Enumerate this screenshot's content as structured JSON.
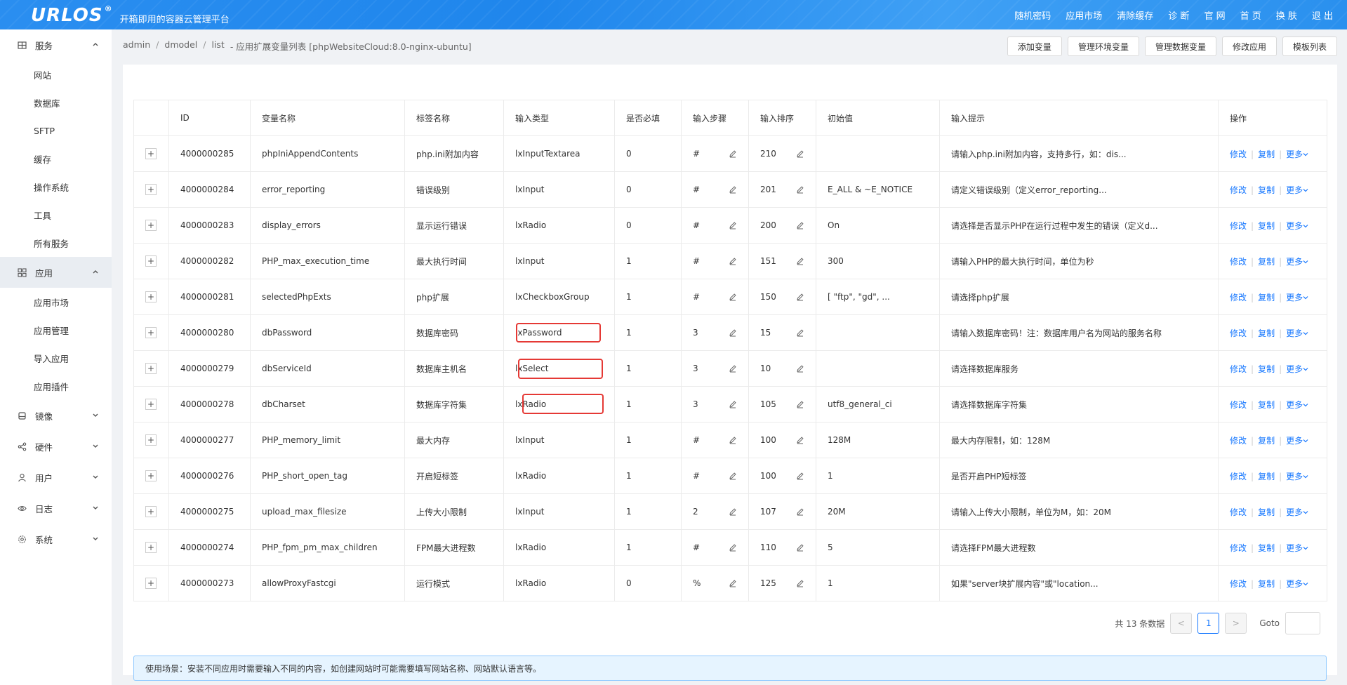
{
  "header": {
    "logo": "URLOS",
    "logo_mark": "®",
    "slogan": "开箱即用的容器云管理平台",
    "nav": [
      "随机密码",
      "应用市场",
      "清除缓存",
      "诊 断",
      "官 网",
      "首 页",
      "换 肤",
      "退 出"
    ]
  },
  "sidebar": {
    "groups": [
      {
        "label": "服务",
        "icon": "grid-icon",
        "expanded": true,
        "items": [
          "网站",
          "数据库",
          "SFTP",
          "缓存",
          "操作系统",
          "工具",
          "所有服务"
        ]
      },
      {
        "label": "应用",
        "icon": "apps-icon",
        "expanded": true,
        "active": true,
        "items": [
          "应用市场",
          "应用管理",
          "导入应用",
          "应用插件"
        ]
      },
      {
        "label": "镜像",
        "icon": "disk-icon",
        "expanded": false,
        "items": []
      },
      {
        "label": "硬件",
        "icon": "share-icon",
        "expanded": false,
        "items": []
      },
      {
        "label": "用户",
        "icon": "user-icon",
        "expanded": false,
        "items": []
      },
      {
        "label": "日志",
        "icon": "eye-icon",
        "expanded": false,
        "items": []
      },
      {
        "label": "系统",
        "icon": "gear-icon",
        "expanded": false,
        "items": []
      }
    ]
  },
  "breadcrumb": [
    "admin",
    "dmodel",
    "list",
    "-  应用扩展变量列表 [phpWebsiteCloud:8.0-nginx-ubuntu]"
  ],
  "actions": [
    "添加变量",
    "管理环境变量",
    "管理数据变量",
    "修改应用",
    "模板列表"
  ],
  "table": {
    "columns": [
      "",
      "ID",
      "变量名称",
      "标签名称",
      "输入类型",
      "是否必填",
      "输入步骤",
      "输入排序",
      "初始值",
      "输入提示",
      "操作"
    ],
    "rows": [
      {
        "id": "4000000285",
        "name": "phpIniAppendContents",
        "label": "php.ini附加内容",
        "type": "lxInputTextarea",
        "required": "0",
        "step": "#",
        "order": "210",
        "init": "",
        "hint": "请输入php.ini附加内容，支持多行，如：dis..."
      },
      {
        "id": "4000000284",
        "name": "error_reporting",
        "label": "错误级别",
        "type": "lxInput",
        "required": "0",
        "step": "#",
        "order": "201",
        "init": "E_ALL & ~E_NOTICE",
        "hint": "请定义错误级别（定义error_reporting..."
      },
      {
        "id": "4000000283",
        "name": "display_errors",
        "label": "显示运行错误",
        "type": "lxRadio",
        "required": "0",
        "step": "#",
        "order": "200",
        "init": "On",
        "hint": "请选择是否显示PHP在运行过程中发生的错误（定义d..."
      },
      {
        "id": "4000000282",
        "name": "PHP_max_execution_time",
        "label": "最大执行时间",
        "type": "lxInput",
        "required": "1",
        "step": "#",
        "order": "151",
        "init": "300",
        "hint": "请输入PHP的最大执行时间，单位为秒"
      },
      {
        "id": "4000000281",
        "name": "selectedPhpExts",
        "label": "php扩展",
        "type": "lxCheckboxGroup",
        "required": "1",
        "step": "#",
        "order": "150",
        "init": "[ \"ftp\", \"gd\", ...",
        "hint": "请选择php扩展"
      },
      {
        "id": "4000000280",
        "name": "dbPassword",
        "label": "数据库密码",
        "type": "lxPassword",
        "required": "1",
        "step": "3",
        "order": "15",
        "init": "",
        "hint": "请输入数据库密码！注：数据库用户名为网站的服务名称"
      },
      {
        "id": "4000000279",
        "name": "dbServiceId",
        "label": "数据库主机名",
        "type": "lxSelect",
        "required": "1",
        "step": "3",
        "order": "10",
        "init": "",
        "hint": "请选择数据库服务"
      },
      {
        "id": "4000000278",
        "name": "dbCharset",
        "label": "数据库字符集",
        "type": "lxRadio",
        "required": "1",
        "step": "3",
        "order": "105",
        "init": "utf8_general_ci",
        "hint": "请选择数据库字符集"
      },
      {
        "id": "4000000277",
        "name": "PHP_memory_limit",
        "label": "最大内存",
        "type": "lxInput",
        "required": "1",
        "step": "#",
        "order": "100",
        "init": "128M",
        "hint": "最大内存限制，如：128M"
      },
      {
        "id": "4000000276",
        "name": "PHP_short_open_tag",
        "label": "开启短标签",
        "type": "lxRadio",
        "required": "1",
        "step": "#",
        "order": "100",
        "init": "1",
        "hint": "是否开启PHP短标签"
      },
      {
        "id": "4000000275",
        "name": "upload_max_filesize",
        "label": "上传大小限制",
        "type": "lxInput",
        "required": "1",
        "step": "2",
        "order": "107",
        "init": "20M",
        "hint": "请输入上传大小限制，单位为M，如：20M"
      },
      {
        "id": "4000000274",
        "name": "PHP_fpm_pm_max_children",
        "label": "FPM最大进程数",
        "type": "lxRadio",
        "required": "1",
        "step": "#",
        "order": "110",
        "init": "5",
        "hint": "请选择FPM最大进程数"
      },
      {
        "id": "4000000273",
        "name": "allowProxyFastcgi",
        "label": "运行模式",
        "type": "lxRadio",
        "required": "0",
        "step": "%",
        "order": "125",
        "init": "1",
        "hint": "如果\"server块扩展内容\"或\"location..."
      }
    ],
    "op_labels": {
      "edit": "修改",
      "copy": "复制",
      "more": "更多"
    }
  },
  "pagination": {
    "total": "共 13 条数据",
    "current": "1",
    "goto": "Goto",
    "prev": "<",
    "next": ">"
  },
  "notice": "使用场景：安装不同应用时需要输入不同的内容，如创建网站时可能需要填写网站名称、网站默认语言等。",
  "colors": {
    "accent": "#1677ff",
    "highlight": "#e53935",
    "topbar": "#2a8ef0"
  }
}
